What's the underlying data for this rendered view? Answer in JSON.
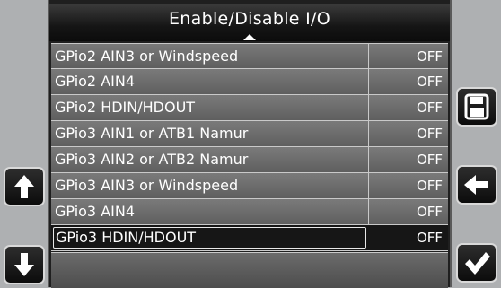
{
  "header": {
    "title": "Enable/Disable I/O"
  },
  "rows": [
    {
      "label": "GPio2 AIN3 or Windspeed",
      "value": "OFF"
    },
    {
      "label": "GPio2 AIN4",
      "value": "OFF"
    },
    {
      "label": "GPio2 HDIN/HDOUT",
      "value": "OFF"
    },
    {
      "label": "GPio3 AIN1 or ATB1 Namur",
      "value": "OFF"
    },
    {
      "label": "GPio3 AIN2 or ATB2 Namur",
      "value": "OFF"
    },
    {
      "label": "GPio3 AIN3 or Windspeed",
      "value": "OFF"
    },
    {
      "label": "GPio3 AIN4",
      "value": "OFF"
    },
    {
      "label": "GPio3 HDIN/HDOUT",
      "value": "OFF"
    }
  ],
  "selected_row": 7,
  "buttons": {
    "up": "arrow-up-icon",
    "down": "arrow-down-icon",
    "save": "save-icon",
    "back": "arrow-left-icon",
    "confirm": "checkmark-icon"
  }
}
